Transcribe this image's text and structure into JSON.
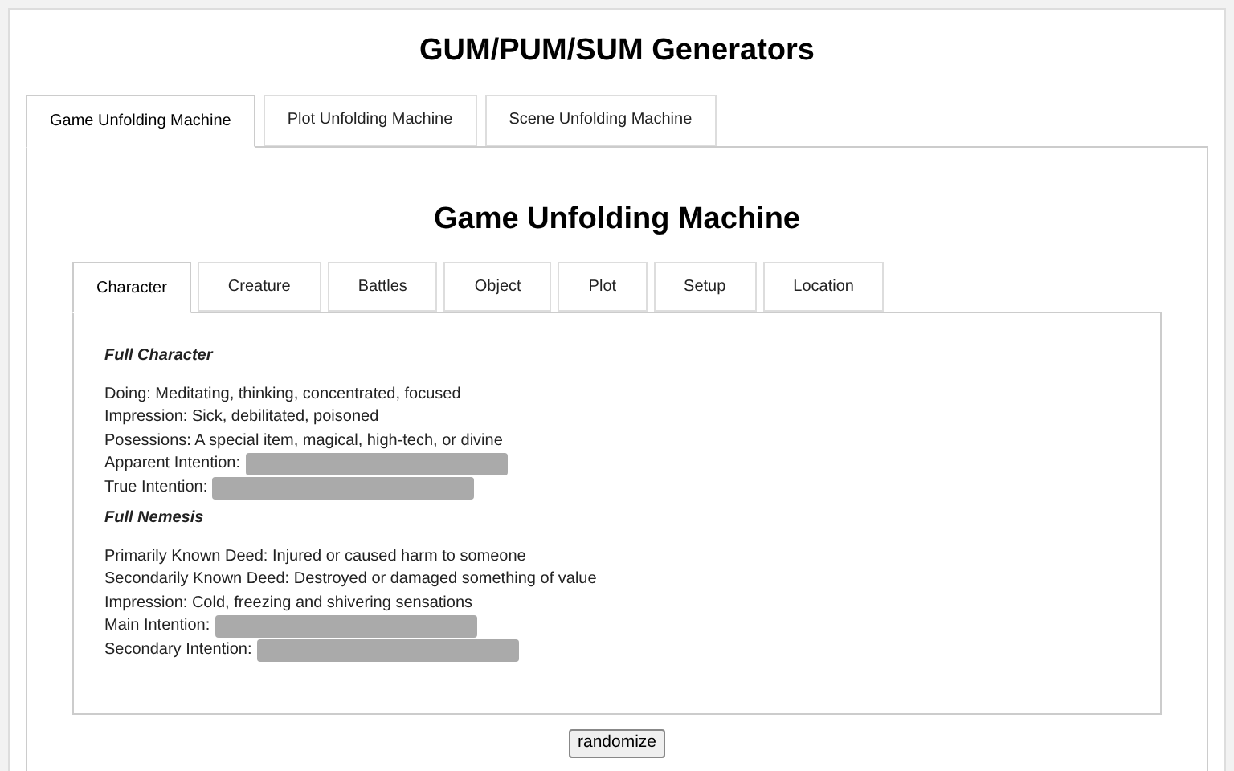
{
  "title": "GUM/PUM/SUM Generators",
  "tabs": [
    {
      "label": "Game Unfolding Machine",
      "selected": true
    },
    {
      "label": "Plot Unfolding Machine",
      "selected": false
    },
    {
      "label": "Scene Unfolding Machine",
      "selected": false
    }
  ],
  "panel": {
    "title": "Game Unfolding Machine",
    "tabs": [
      {
        "label": "Character",
        "selected": true
      },
      {
        "label": "Creature",
        "selected": false
      },
      {
        "label": "Battles",
        "selected": false
      },
      {
        "label": "Object",
        "selected": false
      },
      {
        "label": "Plot",
        "selected": false
      },
      {
        "label": "Setup",
        "selected": false
      },
      {
        "label": "Location",
        "selected": false
      }
    ],
    "sections": [
      {
        "heading": "Full Character",
        "lines": [
          {
            "label": "Doing:",
            "value": "Meditating, thinking, concentrated, focused",
            "redacted": false
          },
          {
            "label": "Impression:",
            "value": "Sick, debilitated, poisoned",
            "redacted": false
          },
          {
            "label": "Posessions:",
            "value": "A special item, magical, high-tech, or divine",
            "redacted": false
          },
          {
            "label": "Apparent Intention:",
            "redacted": true
          },
          {
            "label": "True Intention:",
            "redacted": true
          }
        ]
      },
      {
        "heading": "Full Nemesis",
        "lines": [
          {
            "label": "Primarily Known Deed:",
            "value": "Injured or caused harm to someone",
            "redacted": false
          },
          {
            "label": "Secondarily Known Deed:",
            "value": "Destroyed or damaged something of value",
            "redacted": false
          },
          {
            "label": "Impression:",
            "value": "Cold, freezing and shivering sensations",
            "redacted": false
          },
          {
            "label": "Main Intention:",
            "redacted": true
          },
          {
            "label": "Secondary Intention:",
            "redacted": true
          }
        ]
      }
    ],
    "button": "randomize"
  }
}
